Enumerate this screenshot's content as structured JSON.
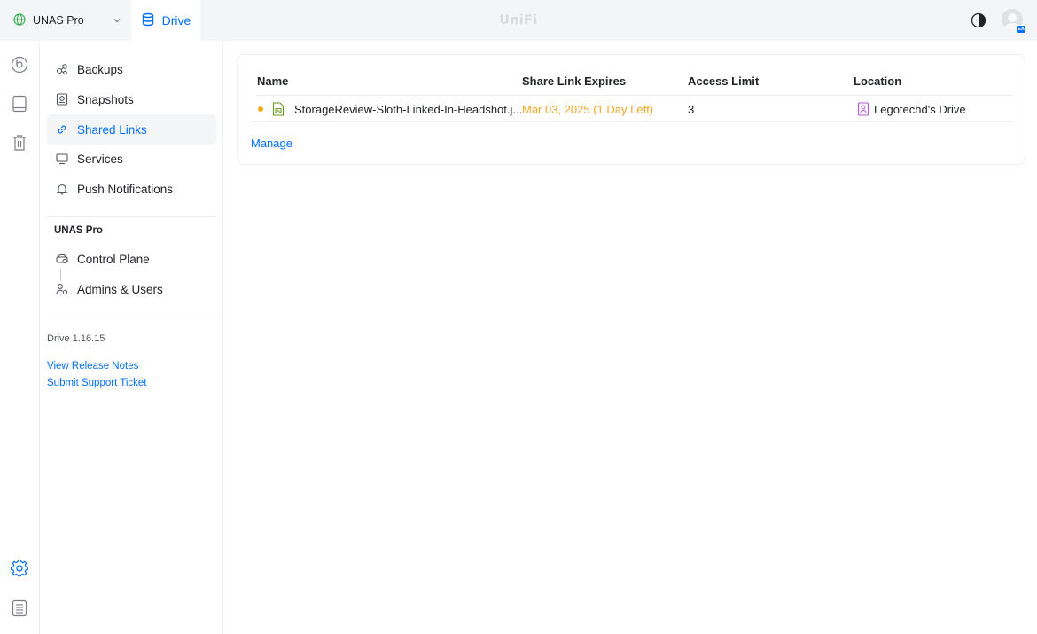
{
  "topbar": {
    "console_name": "UNAS Pro",
    "app_tab": "Drive",
    "brand": "UniFi",
    "avatar_badge": "EA"
  },
  "sidebar": {
    "items": [
      {
        "label": "Backups"
      },
      {
        "label": "Snapshots"
      },
      {
        "label": "Shared Links"
      },
      {
        "label": "Services"
      },
      {
        "label": "Push Notifications"
      }
    ],
    "section_title": "UNAS Pro",
    "section_items": [
      {
        "label": "Control Plane"
      },
      {
        "label": "Admins & Users"
      }
    ],
    "version": "Drive 1.16.15",
    "links": {
      "release_notes": "View Release Notes",
      "support": "Submit Support Ticket"
    }
  },
  "table": {
    "headers": {
      "name": "Name",
      "expires": "Share Link Expires",
      "limit": "Access Limit",
      "location": "Location"
    },
    "rows": [
      {
        "name": "StorageReview-Sloth-Linked-In-Headshot.j...",
        "expires": "Mar 03, 2025 (1 Day Left)",
        "limit": "3",
        "location": "Legotechd's Drive"
      }
    ],
    "manage_label": "Manage"
  },
  "colors": {
    "accent": "#006fff",
    "warning": "#f5a623",
    "file_icon": "#6a9a1f",
    "location_icon": "#b156d6",
    "console_globe": "#37b24d"
  }
}
